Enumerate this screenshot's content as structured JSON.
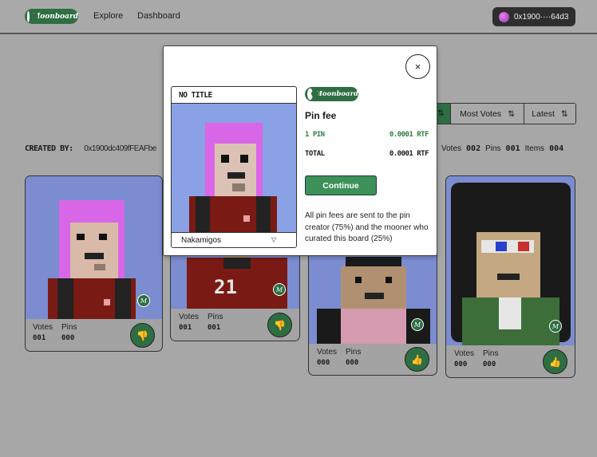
{
  "header": {
    "logo_text": "Moonboard",
    "nav": [
      "Explore",
      "Dashboard"
    ],
    "wallet_address": "0x1900····64d3"
  },
  "board": {
    "created_by_label": "CREATED BY:",
    "created_by_address": "0x1900dc409fFEAFbe",
    "votes_label": "Votes",
    "votes_value": "002",
    "pins_label": "Pins",
    "pins_value": "001",
    "items_label": "Items",
    "items_value": "004"
  },
  "sort": {
    "options": [
      "Most Votes",
      "Latest"
    ],
    "sort_icon": "sort-arrows-icon"
  },
  "cards": [
    {
      "votes_label": "Votes",
      "votes": "001",
      "pins_label": "Pins",
      "pins": "000",
      "action": "downvote",
      "icon": "thumbs-down-icon",
      "badge": "M"
    },
    {
      "votes_label": "Votes",
      "votes": "001",
      "pins_label": "Pins",
      "pins": "001",
      "action": "downvote",
      "icon": "thumbs-down-icon",
      "badge": "M",
      "jersey_number": "21"
    },
    {
      "votes_label": "Votes",
      "votes": "000",
      "pins_label": "Pins",
      "pins": "000",
      "action": "upvote",
      "icon": "thumbs-up-icon",
      "badge": "M"
    },
    {
      "votes_label": "Votes",
      "votes": "000",
      "pins_label": "Pins",
      "pins": "000",
      "action": "upvote",
      "icon": "thumbs-up-icon",
      "badge": "M"
    }
  ],
  "modal": {
    "close_symbol": "×",
    "preview_title": "NO TITLE",
    "collection": "Nakamigos",
    "logo_text": "Moonboard",
    "heading": "Pin fee",
    "pin_count_label": "1 PIN",
    "pin_count_price": "0.0001 RTF",
    "total_label": "TOTAL",
    "total_price": "0.0001 RTF",
    "continue_label": "Continue",
    "note": "All pin fees are sent to the pin creator (75%) and the mooner who curated this board (25%)"
  },
  "colors": {
    "accent_green": "#2f6e43",
    "price_green": "#2f7d43",
    "page_bg": "#a7a7a7",
    "art_bg": "#7b8cd0",
    "hair_pink": "#d966e6",
    "jersey_red": "#7a1a14"
  }
}
